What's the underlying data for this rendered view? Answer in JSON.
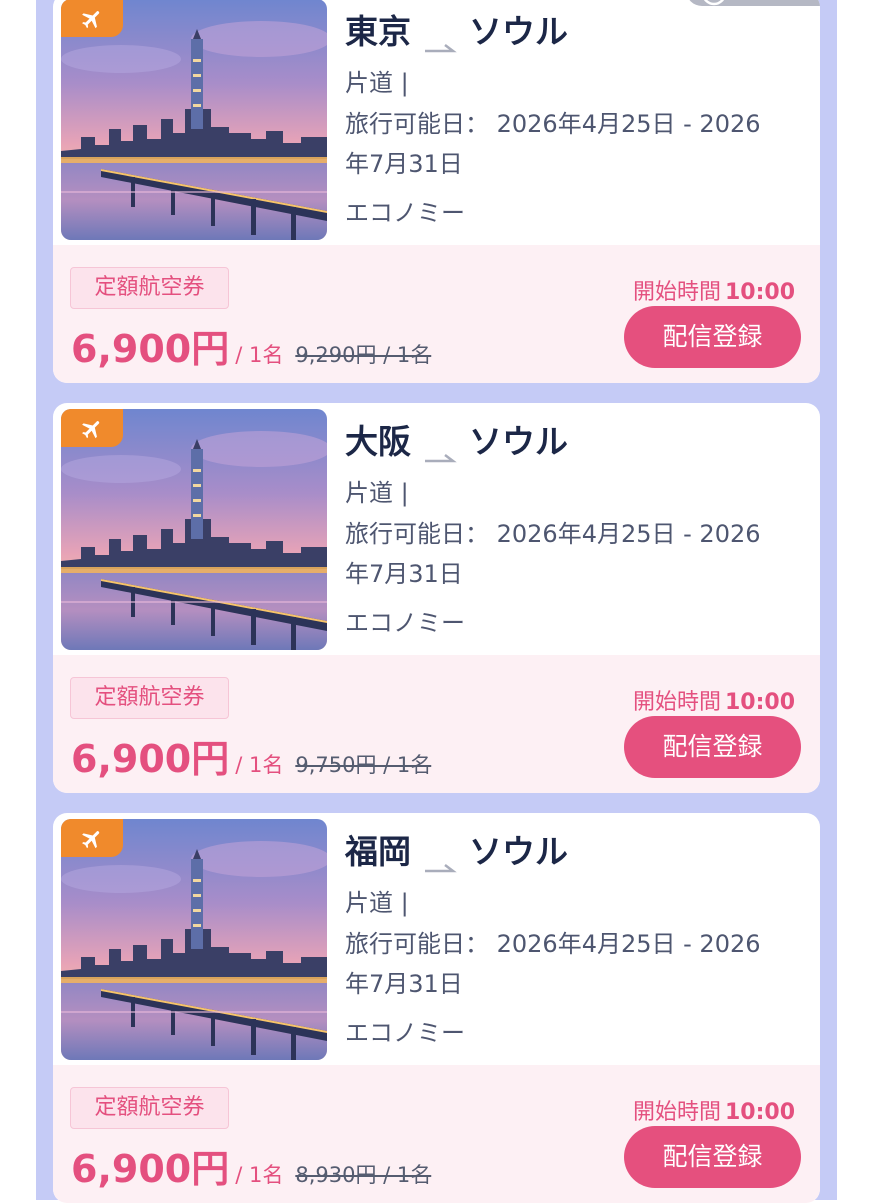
{
  "colors": {
    "accent_pink": "#e4507f",
    "badge_orange": "#f08a2c",
    "list_background": "#c5cbf6",
    "card_bottom": "#fdf0f4",
    "title_navy": "#1c2747"
  },
  "cards": [
    {
      "origin": "東京",
      "destination": "ソウル",
      "trip_type": "片道 |",
      "travel_dates": "旅行可能日： 2026年4月25日 - 2026",
      "travel_dates_end": "年7月31日",
      "cabin_class": "エコノミー",
      "tag": "定額航空券",
      "price": "6,900円",
      "price_unit": "/ 1名",
      "original_price": "9,290円 / 1名",
      "start_label": "開始時間",
      "start_time": "10:00",
      "button_label": "配信登録",
      "icon": "airplane-icon"
    },
    {
      "origin": "大阪",
      "destination": "ソウル",
      "trip_type": "片道 |",
      "travel_dates": "旅行可能日： 2026年4月25日 - 2026",
      "travel_dates_end": "年7月31日",
      "cabin_class": "エコノミー",
      "tag": "定額航空券",
      "price": "6,900円",
      "price_unit": "/ 1名",
      "original_price": "9,750円 / 1名",
      "start_label": "開始時間",
      "start_time": "10:00",
      "button_label": "配信登録",
      "icon": "airplane-icon"
    },
    {
      "origin": "福岡",
      "destination": "ソウル",
      "trip_type": "片道 |",
      "travel_dates": "旅行可能日： 2026年4月25日 - 2026",
      "travel_dates_end": "年7月31日",
      "cabin_class": "エコノミー",
      "tag": "定額航空券",
      "price": "6,900円",
      "price_unit": "/ 1名",
      "original_price": "8,930円 / 1名",
      "start_label": "開始時間",
      "start_time": "10:00",
      "button_label": "配信登録",
      "icon": "airplane-icon"
    }
  ]
}
